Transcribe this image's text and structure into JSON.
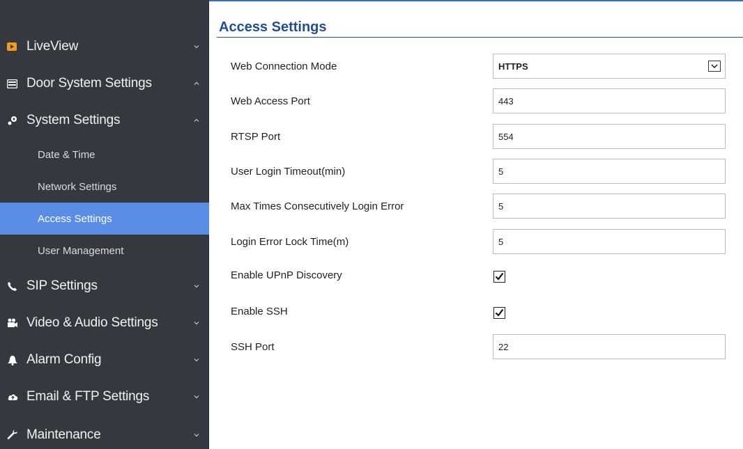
{
  "sidebar": {
    "items": [
      {
        "label": "LiveView",
        "icon": "video-icon"
      },
      {
        "label": "Door System Settings",
        "icon": "door-icon"
      },
      {
        "label": "System Settings",
        "icon": "settings-icon"
      },
      {
        "label": "SIP Settings",
        "icon": "phone-icon"
      },
      {
        "label": "Video & Audio Settings",
        "icon": "camera-icon"
      },
      {
        "label": "Alarm Config",
        "icon": "bell-icon"
      },
      {
        "label": "Email & FTP Settings",
        "icon": "cloud-icon"
      },
      {
        "label": "Maintenance",
        "icon": "wrench-icon"
      }
    ],
    "sub_items": [
      {
        "label": "Date & Time"
      },
      {
        "label": "Network Settings"
      },
      {
        "label": "Access Settings"
      },
      {
        "label": "User Management"
      }
    ],
    "active_sub_item": "Access Settings",
    "active_color": "#5a8ee6",
    "background_color": "#34383f"
  },
  "main": {
    "title": "Access Settings",
    "title_color": "#1f4e96",
    "fields": [
      {
        "label": "Web Connection Mode",
        "type": "select",
        "value": "HTTPS"
      },
      {
        "label": "Web Access Port",
        "type": "text",
        "value": "443"
      },
      {
        "label": "RTSP Port",
        "type": "text",
        "value": "554"
      },
      {
        "label": "User Login Timeout(min)",
        "type": "text",
        "value": "5"
      },
      {
        "label": "Max Times Consecutively Login Error",
        "type": "text",
        "value": "5"
      },
      {
        "label": "Login Error Lock Time(m)",
        "type": "text",
        "value": "5"
      },
      {
        "label": "Enable UPnP Discovery",
        "type": "checkbox",
        "checked": true
      },
      {
        "label": "Enable SSH",
        "type": "checkbox",
        "checked": true
      },
      {
        "label": "SSH Port",
        "type": "text",
        "value": "22"
      }
    ]
  }
}
